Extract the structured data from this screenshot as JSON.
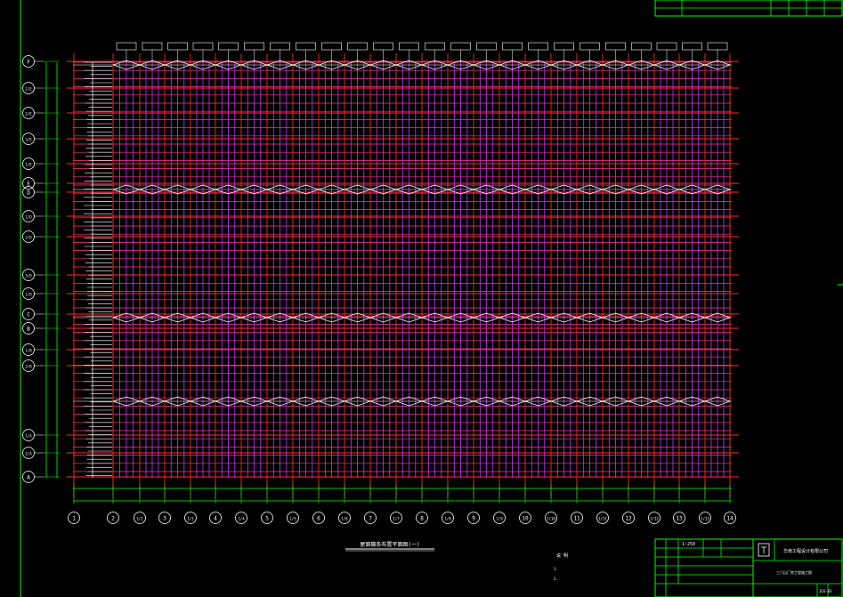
{
  "colors": {
    "background": "#000000",
    "frame": "#00ff00",
    "axis": "#ff2a2a",
    "purlin": "#ff3399",
    "rafter": "#cc33ff",
    "brace": "#ffffff",
    "dimension": "#00ff00",
    "bubble": "#ffffff"
  },
  "bottom_axes": [
    "1",
    "2",
    "1/2",
    "3",
    "1/3",
    "4",
    "1/4",
    "5",
    "1/5",
    "6",
    "1/6",
    "7",
    "1/7",
    "8",
    "1/8",
    "9",
    "1/9",
    "10",
    "1/10",
    "11",
    "1/11",
    "12",
    "1/12",
    "13",
    "1/13",
    "14"
  ],
  "left_axes": [
    "F",
    "1/E",
    "2/E",
    "3/E",
    "1/E",
    "E",
    "D",
    "1/D",
    "2/D",
    "3/D",
    "1/D",
    "C",
    "B",
    "1/B",
    "2/B",
    "1/A",
    "2/A",
    "A"
  ],
  "title_block": {
    "scale": "1:250",
    "company": "华南工程设计有限公司",
    "project": "三门山厂房工程施工图",
    "drawing_no": "JGS-03"
  },
  "drawing_title": "屋面檩条布置平面图(一)",
  "drawing_subtitle": "",
  "notes_heading": "说 明",
  "notes": [
    "1.",
    "2."
  ]
}
